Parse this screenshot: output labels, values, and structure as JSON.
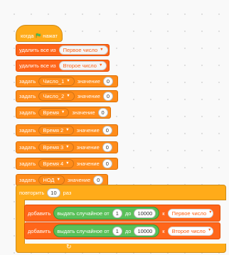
{
  "hat": {
    "text_before": "когда",
    "text_after": "нажат",
    "icon": "green-flag-icon"
  },
  "blocks": [
    {
      "label": "удалить все из",
      "list": "Первое число"
    },
    {
      "label": "удалить все из",
      "list": "Второе число"
    },
    {
      "label": "задать",
      "var": "Число_1",
      "label2": "значение",
      "value": "0"
    },
    {
      "label": "задать",
      "var": "Число_2",
      "label2": "значение",
      "value": "0"
    },
    {
      "label": "задать",
      "var": "Время",
      "label2": "значение",
      "value": "0"
    },
    {
      "label": "задать",
      "var": "Время 2",
      "label2": "значение",
      "value": "0"
    },
    {
      "label": "задать",
      "var": "Время 3",
      "label2": "значение",
      "value": "0"
    },
    {
      "label": "задать",
      "var": "Время 4",
      "label2": "значение",
      "value": "0"
    },
    {
      "label": "задать",
      "var": "НОД",
      "label2": "значение",
      "value": "0"
    }
  ],
  "repeat": {
    "label": "повторить",
    "count": "10",
    "suffix": "раз",
    "arrow": "↻"
  },
  "inner": [
    {
      "label": "добавить",
      "rand_label": "выдать случайное от",
      "from": "1",
      "to_label": "до",
      "to": "10000",
      "k_label": "к",
      "list": "Первое число"
    },
    {
      "label": "добавить",
      "rand_label": "выдать случайное от",
      "from": "1",
      "to_label": "до",
      "to": "10000",
      "k_label": "к",
      "list": "Второе число"
    }
  ],
  "colors": {
    "events": "#ffab19",
    "lists": "#ff661a",
    "variables": "#ff8c1a",
    "operators": "#59c059"
  }
}
